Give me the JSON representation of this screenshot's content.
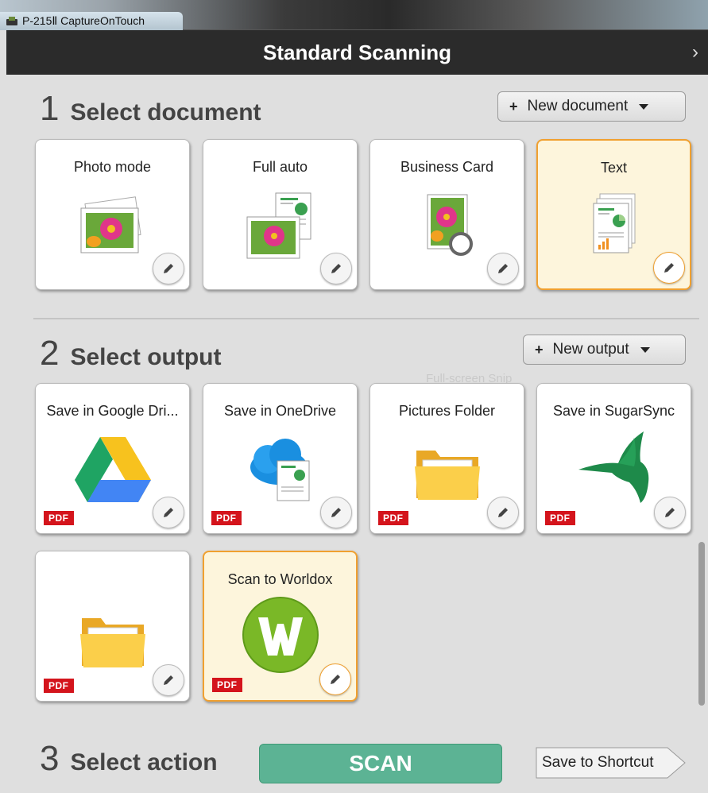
{
  "window": {
    "title": "P-215Ⅱ CaptureOnTouch"
  },
  "header": {
    "title": "Standard Scanning",
    "next_icon": "chevron-right-icon"
  },
  "section1": {
    "number": "1",
    "label": "Select document",
    "new_button": "New document",
    "cards": [
      {
        "title": "Photo mode",
        "icon": "photo-icon",
        "selected": false
      },
      {
        "title": "Full auto",
        "icon": "full-auto-icon",
        "selected": false
      },
      {
        "title": "Business Card",
        "icon": "business-card-icon",
        "selected": false
      },
      {
        "title": "Text",
        "icon": "text-document-icon",
        "selected": true
      }
    ]
  },
  "section2": {
    "number": "2",
    "label": "Select output",
    "new_button": "New output",
    "cards": [
      {
        "title": "Save in Google Dri...",
        "icon": "google-drive-icon",
        "badge": "PDF",
        "selected": false
      },
      {
        "title": "Save in OneDrive",
        "icon": "onedrive-icon",
        "badge": "PDF",
        "selected": false
      },
      {
        "title": "Pictures Folder",
        "icon": "folder-icon",
        "badge": "PDF",
        "selected": false
      },
      {
        "title": "Save in SugarSync",
        "icon": "sugarsync-icon",
        "badge": "PDF",
        "selected": false
      },
      {
        "title": "",
        "icon": "folder-icon",
        "badge": "PDF",
        "selected": false
      },
      {
        "title": "Scan to Worldox",
        "icon": "worldox-icon",
        "badge": "PDF",
        "selected": true
      }
    ],
    "ghost_text": "Full-screen Snip"
  },
  "section3": {
    "number": "3",
    "label": "Select action",
    "scan_button": "SCAN",
    "shortcut_button": "Save to Shortcut"
  },
  "colors": {
    "accent_selected": "#f0a030",
    "scan": "#5cb394",
    "pdf_badge": "#d4141c",
    "header": "#2b2b2b"
  }
}
